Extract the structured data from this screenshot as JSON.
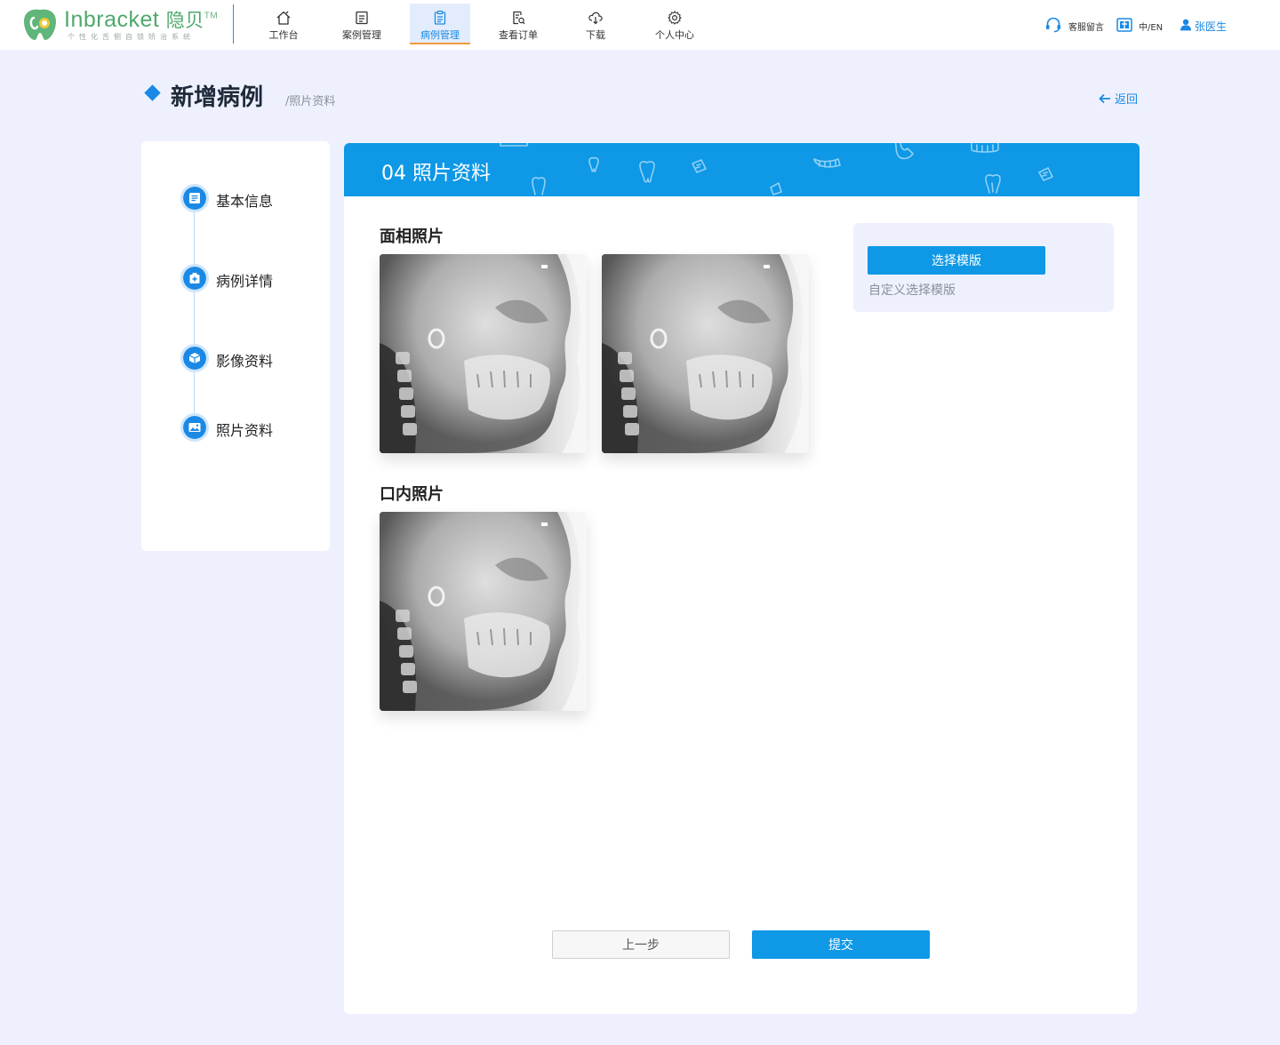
{
  "brand": {
    "name": "Inbracket",
    "cn": "隐贝",
    "tm": "TM",
    "tagline": "个性化舌侧自锁矫治系统",
    "accent": "#4fa86c"
  },
  "nav": {
    "items": [
      {
        "label": "工作台",
        "icon": "home-icon"
      },
      {
        "label": "案例管理",
        "icon": "case-list-icon"
      },
      {
        "label": "病例管理",
        "icon": "clipboard-icon",
        "active": true
      },
      {
        "label": "查看订单",
        "icon": "order-search-icon"
      },
      {
        "label": "下载",
        "icon": "cloud-download-icon"
      },
      {
        "label": "个人中心",
        "icon": "gear-icon"
      }
    ]
  },
  "tools": {
    "service": "客服留言",
    "lang": "中/EN",
    "user": "张医生"
  },
  "page": {
    "title": "新增病例",
    "breadcrumb": "/照片资料",
    "back": "返回"
  },
  "steps": [
    {
      "label": "基本信息",
      "icon": "form-icon"
    },
    {
      "label": "病例详情",
      "icon": "medical-case-icon"
    },
    {
      "label": "影像资料",
      "icon": "cube-icon"
    },
    {
      "label": "照片资料",
      "icon": "image-icon"
    }
  ],
  "main": {
    "banner_title": "04 照片资料",
    "face_section": "面相照片",
    "intraoral_section": "口内照片",
    "template_button": "选择模版",
    "template_hint": "自定义选择模版",
    "prev_button": "上一步",
    "submit_button": "提交"
  },
  "colors": {
    "primary": "#0e98e6",
    "page_bg": "#eef1fd",
    "active_tab_underline": "#f29b3c"
  }
}
